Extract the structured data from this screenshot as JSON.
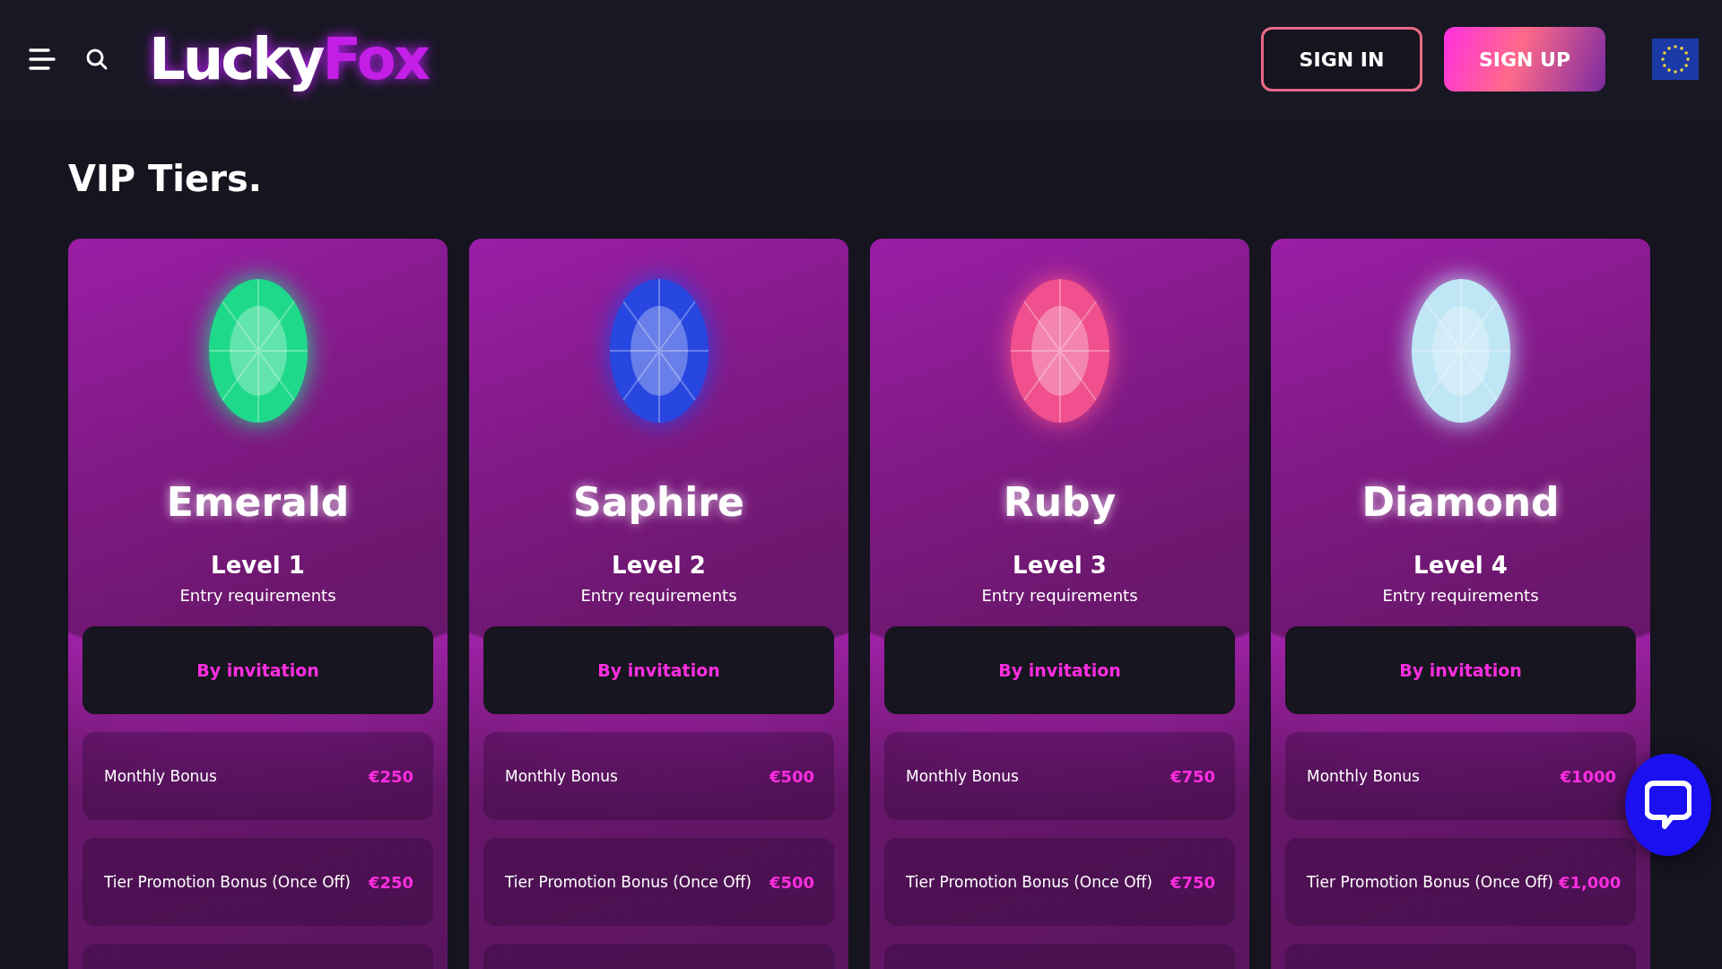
{
  "header": {
    "logo": {
      "first": "Lucky",
      "second": "Fox"
    },
    "buttons": [
      {
        "label": "SIGN IN",
        "kind": "outline"
      },
      {
        "label": "SIGN UP",
        "kind": "filled"
      }
    ]
  },
  "title": "VIP Tiers.",
  "tiers": [
    {
      "name": "Emerald",
      "color": "#1fd98a",
      "level": "Level 1",
      "requirement_label": "Entry requirements",
      "requirement": "By invitation",
      "rows": [
        {
          "label": "Monthly Bonus",
          "value": "€250"
        },
        {
          "label": "Tier Promotion Bonus (Once Off)",
          "value": "€250"
        }
      ]
    },
    {
      "name": "Saphire",
      "color": "#2747e0",
      "level": "Level 2",
      "requirement_label": "Entry requirements",
      "requirement": "By invitation",
      "rows": [
        {
          "label": "Monthly Bonus",
          "value": "€500"
        },
        {
          "label": "Tier Promotion Bonus (Once Off)",
          "value": "€500"
        }
      ]
    },
    {
      "name": "Ruby",
      "color": "#f0508e",
      "level": "Level 3",
      "requirement_label": "Entry requirements",
      "requirement": "By invitation",
      "rows": [
        {
          "label": "Monthly Bonus",
          "value": "€750"
        },
        {
          "label": "Tier Promotion Bonus (Once Off)",
          "value": "€750"
        }
      ]
    },
    {
      "name": "Diamond",
      "color": "#bfe6f5",
      "level": "Level 4",
      "requirement_label": "Entry requirements",
      "requirement": "By invitation",
      "rows": [
        {
          "label": "Monthly Bonus",
          "value": "€1000"
        },
        {
          "label": "Tier Promotion Bonus (Once Off)",
          "value": "€1,000"
        }
      ]
    }
  ]
}
